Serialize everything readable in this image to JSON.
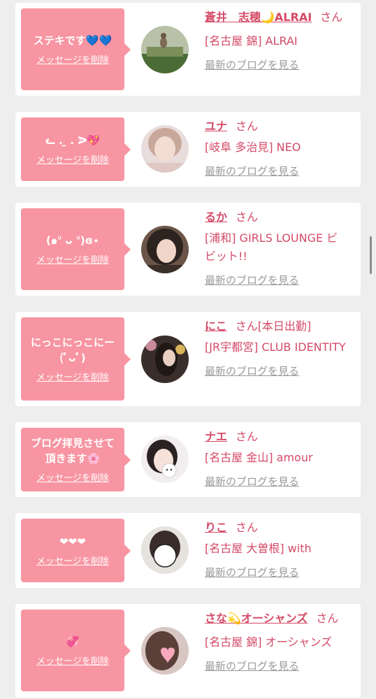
{
  "items": [
    {
      "message": "ステキです💙💙",
      "delete_label": "メッセージを削除",
      "name": "蒼井　志穂🌙ALRAI",
      "honorific": "さん",
      "shop": "[名古屋 錦] ALRAI",
      "blog_link": "最新のブログを見る"
    },
    {
      "message": "ᓚ . ̫ . ᐷ💖",
      "delete_label": "メッセージを削除",
      "name": "ユナ",
      "honorific": "さん",
      "shop": "[岐阜 多治見] NEO",
      "blog_link": "最新のブログを見る"
    },
    {
      "message": "(๑ᐡ ᴗ ᐡ)ɞ⋆",
      "delete_label": "メッセージを削除",
      "name": "るか",
      "honorific": "さん",
      "shop": "[浦和] GIRLS LOUNGE ビビット!!",
      "blog_link": "最新のブログを見る"
    },
    {
      "message": "にっこにっこにー(ﾟᴗﾟ)",
      "delete_label": "メッセージを削除",
      "name": "にこ",
      "honorific": "さん[本日出勤]",
      "shop": "[JR宇都宮] CLUB IDENTITY",
      "blog_link": "最新のブログを見る"
    },
    {
      "message": "ブログ拝見させて頂きます🌸",
      "delete_label": "メッセージを削除",
      "name": "ナエ",
      "honorific": "さん",
      "shop": "[名古屋 金山] amour",
      "blog_link": "最新のブログを見る"
    },
    {
      "message": "❤❤❤",
      "delete_label": "メッセージを削除",
      "name": "りこ",
      "honorific": "さん",
      "shop": "[名古屋 大曽根] with",
      "blog_link": "最新のブログを見る"
    },
    {
      "message": "💞",
      "delete_label": "メッセージを削除",
      "name": "さな💫オーシャンズ",
      "honorific": "さん",
      "shop": "[名古屋 錦] オーシャンズ",
      "blog_link": "最新のブログを見る"
    }
  ],
  "colors": {
    "bubble": "#f895a2",
    "accent_text": "#d44a66",
    "muted_link": "#9a9a9a",
    "background": "#eeeeee"
  }
}
